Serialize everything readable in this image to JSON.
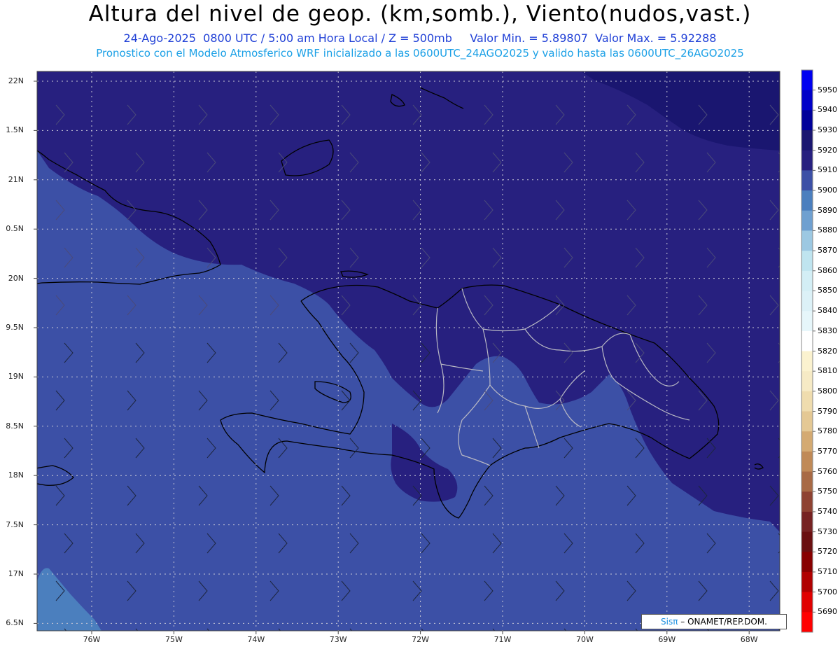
{
  "header": {
    "title": "Altura del nivel de geop. (km,somb.), Viento(nudos,vast.)",
    "date_line": "24-Ago-2025  0800 UTC / 5:00 am Hora Local / Z = 500mb     Valor Min. = 5.89807  Valor Max. = 5.92288",
    "model_line": "Pronostico con el Modelo Atmosferico WRF inicializado a las 0600UTC_24AGO2025 y valido hasta las  0600UTC_26AGO2025"
  },
  "axes": {
    "lat_labels": [
      "22N",
      "1.5N",
      "21N",
      "0.5N",
      "20N",
      "9.5N",
      "19N",
      "8.5N",
      "18N",
      "7.5N",
      "17N",
      "6.5N"
    ],
    "lon_labels": [
      "76W",
      "75W",
      "74W",
      "73W",
      "72W",
      "71W",
      "70W",
      "69W",
      "68W"
    ]
  },
  "colorbar": {
    "labels": [
      "5950",
      "5940",
      "5930",
      "5920",
      "5910",
      "5900",
      "5890",
      "5880",
      "5870",
      "5860",
      "5850",
      "5840",
      "5830",
      "5820",
      "5810",
      "5800",
      "5790",
      "5780",
      "5770",
      "5760",
      "5750",
      "5740",
      "5730",
      "5720",
      "5710",
      "5700",
      "5690"
    ],
    "colors": [
      "#0000f0",
      "#0000c8",
      "#00009a",
      "#1a1670",
      "#27207f",
      "#3c50a6",
      "#4b7fbe",
      "#6fa0d0",
      "#9cc8e2",
      "#bfe4ef",
      "#d3eef5",
      "#dcf1f7",
      "#e6f6fa",
      "#ffffff",
      "#fbf2cf",
      "#f6eac5",
      "#efdcae",
      "#e4c894",
      "#d4aa72",
      "#c08a57",
      "#a86a45",
      "#8e4232",
      "#762222",
      "#6a0f10",
      "#880000",
      "#b00000",
      "#e00000",
      "#ff0000"
    ]
  },
  "field_colors": {
    "z5920": "#1a1670",
    "z5910": "#27207f",
    "z5900": "#3c50a6",
    "z5890": "#4b7fbe"
  },
  "credit": {
    "sis": "Sisπ",
    "org": " – ONAMET/REP.DOM."
  }
}
